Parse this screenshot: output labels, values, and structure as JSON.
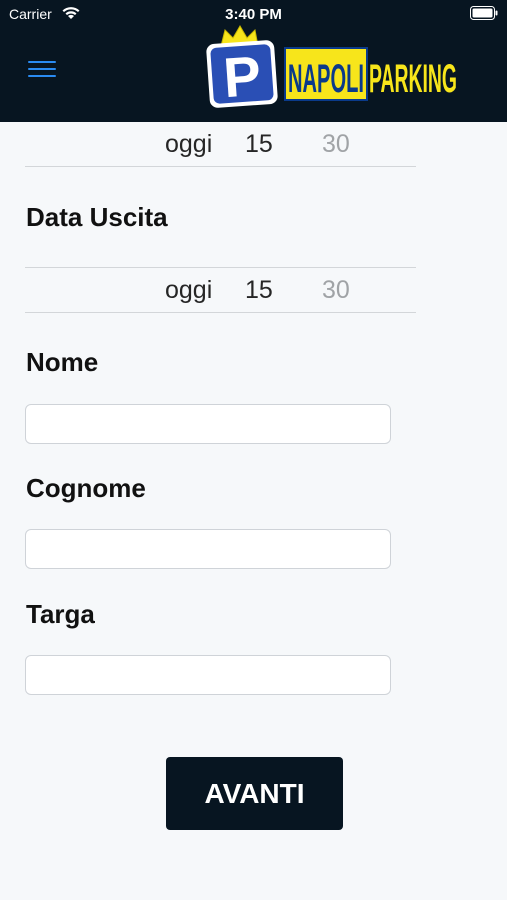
{
  "status_bar": {
    "carrier": "Carrier",
    "time": "3:40 PM"
  },
  "header": {
    "menu_icon": "hamburger-menu-icon",
    "logo": {
      "badge_letter": "P",
      "text_left": "NAPOLI",
      "text_right": "PARKING"
    }
  },
  "entrata_picker": {
    "day": "oggi",
    "hour": "15",
    "minute": "30"
  },
  "uscita": {
    "label": "Data Uscita",
    "day": "oggi",
    "hour": "15",
    "minute": "30"
  },
  "form": {
    "nome_label": "Nome",
    "nome_value": "",
    "cognome_label": "Cognome",
    "cognome_value": "",
    "targa_label": "Targa",
    "targa_value": ""
  },
  "button": {
    "label": "AVANTI"
  },
  "colors": {
    "header_bg": "#071521",
    "accent_blue": "#2a8bf2",
    "logo_yellow": "#f7e51b",
    "logo_blue": "#2a4fb5"
  }
}
